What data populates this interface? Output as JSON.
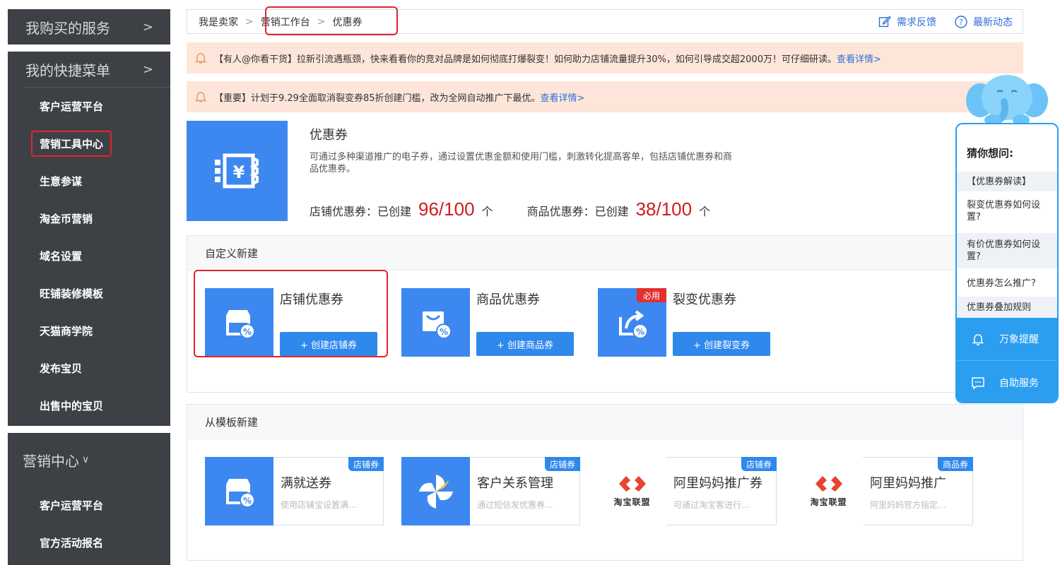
{
  "sidebar": {
    "block1": {
      "title": "我购买的服务",
      "chevron": ">"
    },
    "block2": {
      "title": "我的快捷菜单",
      "chevron": ">",
      "items": [
        "客户运营平台",
        "营销工具中心",
        "生意参谋",
        "淘金币营销",
        "域名设置",
        "旺铺装修模板",
        "天猫商学院",
        "发布宝贝",
        "出售中的宝贝"
      ]
    },
    "block3": {
      "title": "营销中心",
      "chevron": "∨",
      "items": [
        "客户运营平台",
        "官方活动报名"
      ]
    }
  },
  "topbar": {
    "breadcrumb": [
      "我是卖家",
      "营销工作台",
      "优惠券"
    ],
    "separator": ">",
    "feedback": "需求反馈",
    "news": "最新动态"
  },
  "notices": [
    {
      "text": "【有人@你看干货】拉新引流遇瓶颈，快来看看你的竞对品牌是如何彻底打爆裂变！如何助力店铺流量提升30%，如何引导成交超2000万！可仔细研读。",
      "link": "查看详情>"
    },
    {
      "text": "【重要】计划于9.29全面取消裂变券85折创建门槛，改为全网自动推广下最优。",
      "link": "查看详情>"
    }
  ],
  "hero": {
    "title": "优惠券",
    "desc": "可通过多种渠道推广的电子券，通过设置优惠金额和使用门槛，刺激转化提高客单，包括店铺优惠券和商品优惠券。",
    "shop_label": "店铺优惠券：已创建",
    "shop_count": "96/100",
    "shop_unit": "个",
    "item_label": "商品优惠券：已创建",
    "item_count": "38/100",
    "item_unit": "个"
  },
  "custom": {
    "title": "自定义新建",
    "cards": [
      {
        "title": "店铺优惠券",
        "button": "+ 创建店铺券"
      },
      {
        "title": "商品优惠券",
        "button": "+ 创建商品券"
      },
      {
        "title": "裂变优惠券",
        "button": "+ 创建裂变券",
        "badge": "必用"
      }
    ]
  },
  "template": {
    "title": "从模板新建",
    "cards": [
      {
        "title": "满就送券",
        "desc": "使用店铺宝设置满…",
        "tag": "店铺券"
      },
      {
        "title": "客户关系管理",
        "desc": "通过短信发优惠券…",
        "tag": "店铺券"
      },
      {
        "title": "阿里妈妈推广券",
        "desc": "可通过淘宝客进行…",
        "tag": "店铺券",
        "logo": "淘宝联盟"
      },
      {
        "title": "阿里妈妈推广",
        "desc": "阿里妈妈官方指定…",
        "tag": "商品券",
        "logo": "淘宝联盟"
      }
    ]
  },
  "helper": {
    "title": "猜你想问:",
    "questions": [
      "【优惠券解读】",
      "裂变优惠券如何设置?",
      "有价优惠券如何设置?",
      "优惠券怎么推广?",
      "优惠券叠加规则"
    ],
    "reminder": "万象提醒",
    "self_service": "自助服务"
  },
  "colors": {
    "accent": "#3c88f0",
    "highlight": "#e0242c",
    "sidebar": "#3d4145",
    "notice": "#fde5d9",
    "count": "#cc1e1e"
  }
}
